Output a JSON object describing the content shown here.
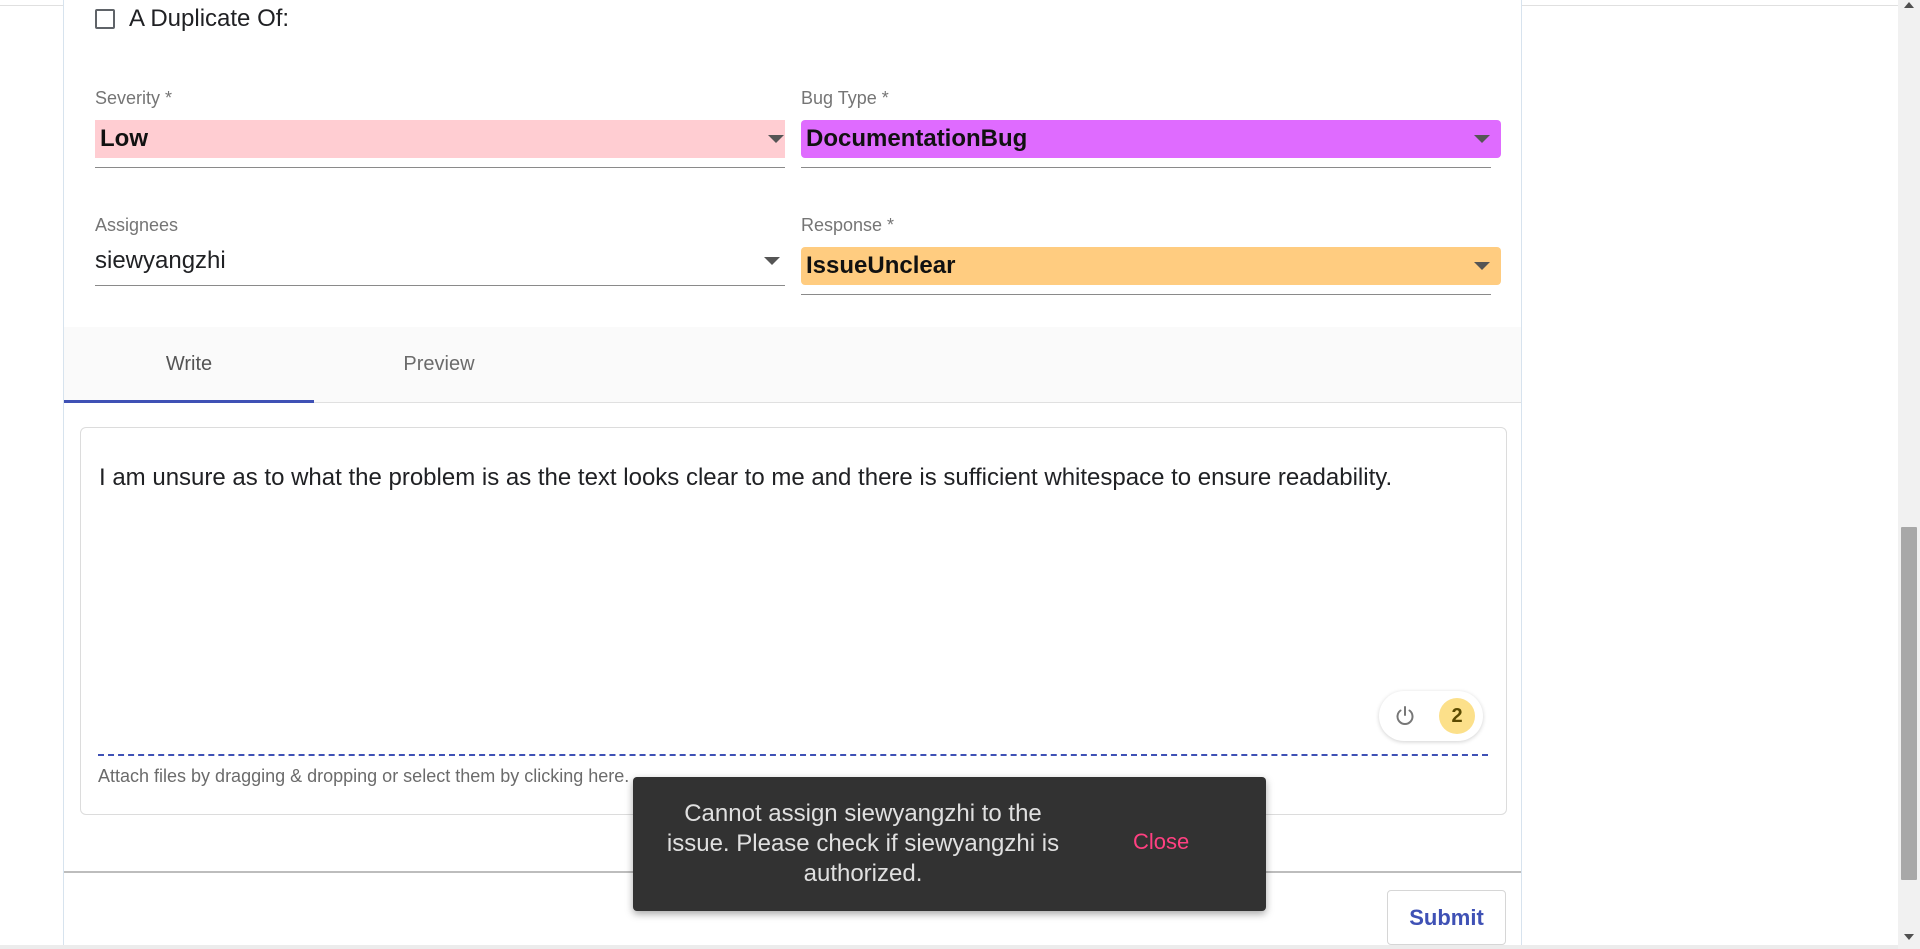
{
  "duplicate": {
    "label": "A Duplicate Of:",
    "checked": false
  },
  "severity": {
    "label": "Severity *",
    "value": "Low",
    "color": "#ffcdd2"
  },
  "bug_type": {
    "label": "Bug Type *",
    "value": "DocumentationBug",
    "color": "#df6bff"
  },
  "assignees": {
    "label": "Assignees",
    "value": "siewyangzhi"
  },
  "response": {
    "label": "Response *",
    "value": "IssueUnclear",
    "color": "#ffcc80"
  },
  "tabs": [
    {
      "label": "Write",
      "active": true
    },
    {
      "label": "Preview",
      "active": false
    }
  ],
  "editor": {
    "text": "I am unsure as to what the problem is as the text looks clear to me and there is sufficient whitespace to ensure readability.",
    "attach_hint": "Attach files by dragging & dropping or select them by clicking here.",
    "badge_count": "2",
    "icon": "power-icon"
  },
  "submit_label": "Submit",
  "snackbar": {
    "message": "Cannot assign siewyangzhi to the issue. Please check if siewyangzhi is authorized.",
    "action": "Close"
  },
  "colors": {
    "accent": "#3f51b5",
    "snackbar_action": "#ff4081"
  }
}
